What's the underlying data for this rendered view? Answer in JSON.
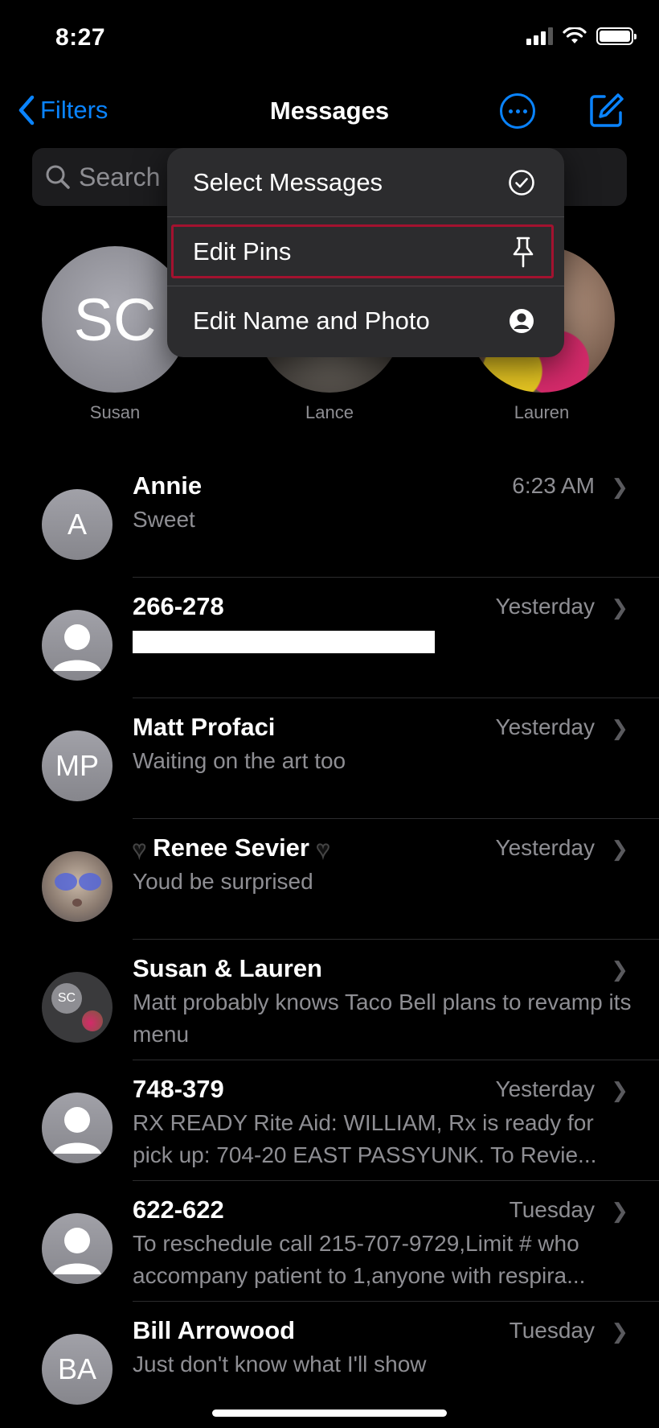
{
  "status": {
    "time": "8:27"
  },
  "nav": {
    "back_label": "Filters",
    "title": "Messages"
  },
  "search": {
    "placeholder": "Search"
  },
  "menu": {
    "items": [
      {
        "label": "Select Messages",
        "icon": "checkmark-circle-icon"
      },
      {
        "label": "Edit Pins",
        "icon": "pin-icon",
        "highlighted": true
      },
      {
        "label": "Edit Name and Photo",
        "icon": "person-circle-icon"
      }
    ]
  },
  "pinned": [
    {
      "name": "Susan",
      "initials": "SC"
    },
    {
      "name": "Lance"
    },
    {
      "name": "Lauren"
    }
  ],
  "conversations": [
    {
      "name": "Annie",
      "time": "6:23 AM",
      "preview": "Sweet",
      "initials": "A"
    },
    {
      "name": "266-278",
      "time": "Yesterday",
      "preview": ""
    },
    {
      "name": "Matt Profaci",
      "time": "Yesterday",
      "preview": "Waiting on the art too",
      "initials": "MP"
    },
    {
      "name": "Renee Sevier",
      "time": "Yesterday",
      "preview": "Youd be surprised"
    },
    {
      "name": "Susan & Lauren",
      "time": "",
      "preview": "Matt probably knows Taco Bell plans to revamp its menu",
      "initials": "SC"
    },
    {
      "name": "748-379",
      "time": "Yesterday",
      "preview": "RX READY Rite Aid: WILLIAM, Rx is ready for pick up: 704-20 EAST PASSYUNK. To Revie..."
    },
    {
      "name": "622-622",
      "time": "Tuesday",
      "preview": "To reschedule call 215-707-9729,Limit # who accompany patient to 1,anyone with respira..."
    },
    {
      "name": "Bill Arrowood",
      "time": "Tuesday",
      "preview": "Just don't know what I'll show",
      "initials": "BA"
    }
  ],
  "colors": {
    "accent": "#0a84ff",
    "highlight_border": "#a3122f",
    "background": "#000000"
  }
}
